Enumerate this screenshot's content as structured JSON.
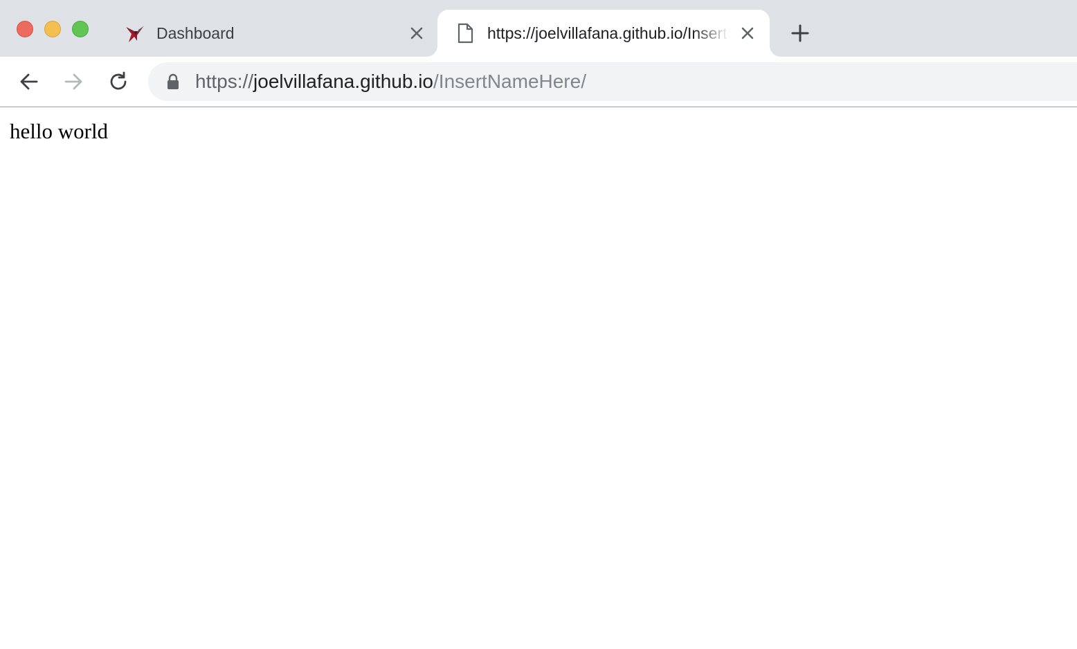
{
  "window": {
    "traffic_lights": {
      "close_color": "#ed6a5e",
      "minimize_color": "#f5bf4f",
      "maximize_color": "#61c554"
    }
  },
  "tabs": [
    {
      "title": "Dashboard",
      "icon": "bird-logo-icon",
      "active": false
    },
    {
      "title": "https://joelvillafana.github.io/InsertNameHere/",
      "icon": "document-icon",
      "active": true
    }
  ],
  "toolbar": {
    "back_icon": "arrow-left-icon",
    "forward_icon": "arrow-right-icon",
    "reload_icon": "reload-icon",
    "new_tab_icon": "plus-icon"
  },
  "omnibox": {
    "secure_icon": "lock-icon",
    "scheme": "https://",
    "host": "joelvillafana.github.io",
    "path": "/InsertNameHere/"
  },
  "page": {
    "body_text": "hello world"
  }
}
